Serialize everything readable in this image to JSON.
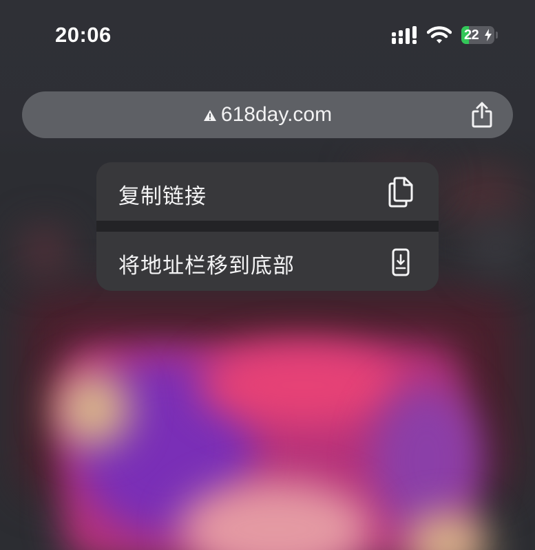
{
  "status_bar": {
    "time": "20:06",
    "signal_icon": "cellular-signal-icon",
    "wifi_icon": "wifi-icon",
    "battery": {
      "level": "22",
      "percent": 22,
      "charging": true,
      "fill_color": "#33c759"
    }
  },
  "address_bar": {
    "warning_icon": "warning-triangle-icon",
    "url": "618day.com",
    "share_icon": "share-icon"
  },
  "context_menu": {
    "items": [
      {
        "label": "复制链接",
        "icon": "copy-icon"
      },
      {
        "label": "将地址栏移到底部",
        "icon": "phone-arrow-down-icon"
      }
    ]
  },
  "colors": {
    "background": "#2b2c31",
    "address_bar": "#5e6065",
    "menu_item": "#38383b",
    "menu_separator": "#232326",
    "battery_green": "#33c759"
  }
}
